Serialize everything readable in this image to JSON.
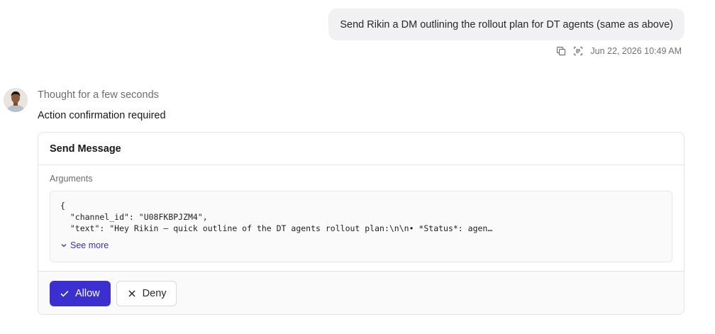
{
  "user_message": {
    "text": "Send Rikin a DM outlining the rollout plan for DT agents (same as above)",
    "timestamp": "Jun 22, 2026 10:49 AM",
    "icons": [
      "copy-icon",
      "inspect-icon"
    ]
  },
  "assistant": {
    "thought": "Thought for a few seconds",
    "confirmation_title": "Action confirmation required"
  },
  "action_card": {
    "title": "Send Message",
    "arguments_label": "Arguments",
    "code_lines": [
      "{",
      "  \"channel_id\": \"U08FKBPJZM4\",",
      "  \"text\": \"Hey Rikin — quick outline of the DT agents rollout plan:\\n\\n• *Status*: agen…"
    ],
    "see_more_label": "See more",
    "allow_label": "Allow",
    "deny_label": "Deny"
  },
  "colors": {
    "accent": "#3c2fd0",
    "link": "#3b2fc9",
    "bubble_bg": "#f1f1f3",
    "border": "#e4e4e7"
  }
}
